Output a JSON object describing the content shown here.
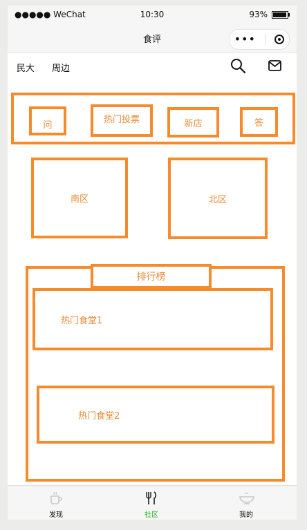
{
  "status_bar": {
    "carrier": "●●●●● WeChat",
    "time": "10:30",
    "battery": "93%",
    "battery_fraction": 0.93
  },
  "nav_bar": {
    "title": "食评",
    "more_icon": "more-dots-icon",
    "close_icon": "target-circle-icon"
  },
  "top_bar": {
    "locations": [
      "民大",
      "周边"
    ],
    "search_icon": "search-icon",
    "mail_icon": "mail-icon"
  },
  "quick_actions": [
    "问",
    "热门投票",
    "新店",
    "答"
  ],
  "zones": [
    "南区",
    "北区"
  ],
  "ranking": {
    "title": "排行榜",
    "items": [
      "热门食堂1",
      "热门食堂2"
    ]
  },
  "tab_bar": {
    "tabs": [
      {
        "label": "发现",
        "icon": "coffee-cup-icon",
        "active": false
      },
      {
        "label": "社区",
        "icon": "fork-knife-icon",
        "active": true
      },
      {
        "label": "我的",
        "icon": "bowl-icon",
        "active": false
      }
    ]
  },
  "colors": {
    "accent_orange": "#f78b2c",
    "text_orange": "#e98a34",
    "tab_active": "#1aad19"
  }
}
